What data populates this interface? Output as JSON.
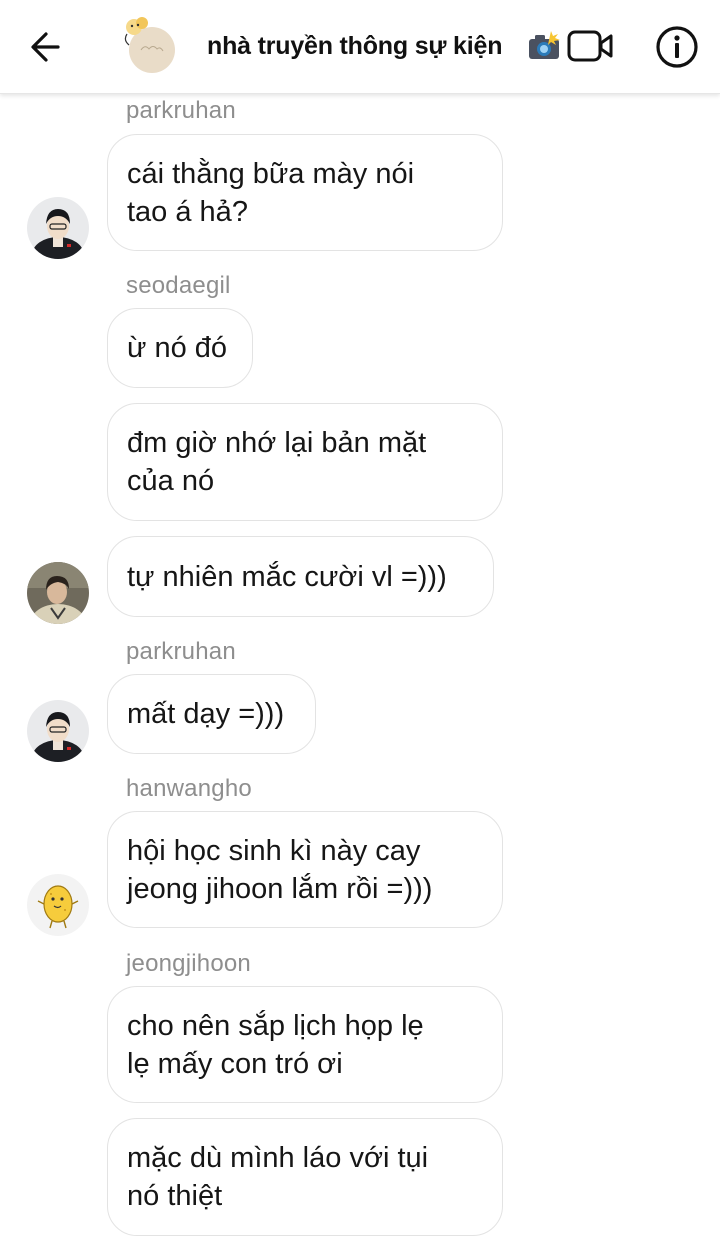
{
  "header": {
    "title": "nhà truyền thông sự kiện",
    "back_icon": "arrow-left-icon",
    "video_icon": "video-call-icon",
    "info_icon": "info-icon"
  },
  "messages": [
    {
      "sender": "parkruhan",
      "texts": [
        "cái thằng bữa mày nói\ntao á hả?"
      ],
      "avatar": "avatar-parkruhan"
    },
    {
      "sender": "seodaegil",
      "texts": [
        "ừ nó đó",
        "đm giờ nhớ lại bản mặt\ncủa nó",
        "tự nhiên mắc cười vl =)))"
      ],
      "avatar": "avatar-seodaegil"
    },
    {
      "sender": "parkruhan",
      "texts": [
        "mất dạy =)))"
      ],
      "avatar": "avatar-parkruhan"
    },
    {
      "sender": "hanwangho",
      "texts": [
        "hội học sinh kì này cay\njeong jihoon lắm rồi =)))"
      ],
      "avatar": "avatar-hanwangho"
    },
    {
      "sender": "jeongjihoon",
      "texts": [
        "cho nên sắp lịch họp lẹ\nlẹ mấy con tró ơi",
        "mặc dù mình láo với tụi\nnó thiệt"
      ],
      "avatar": null
    }
  ],
  "colors": {
    "sender_name": "#8e8e8e",
    "bubble_border": "#e3e3e3",
    "text": "#161616",
    "background": "#ffffff"
  }
}
